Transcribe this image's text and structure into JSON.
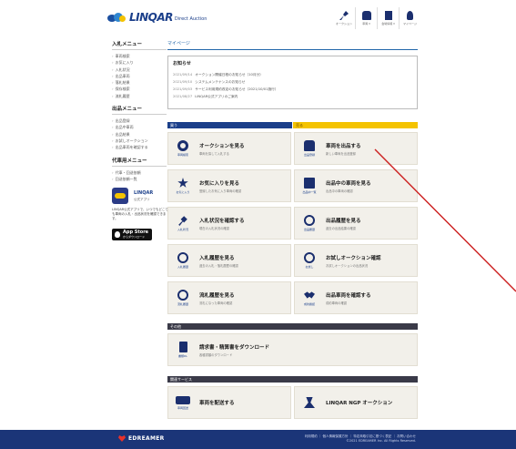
{
  "header": {
    "logo_text": "LINQAR",
    "logo_sub": "Direct Auction",
    "icons": [
      {
        "icon": "hammer-icon",
        "label": "オークション"
      },
      {
        "icon": "car-icon",
        "label": "車両 ▾"
      },
      {
        "icon": "building-icon",
        "label": "会場情報 ▾"
      },
      {
        "icon": "user-icon",
        "label": "マイページ"
      }
    ]
  },
  "sidebar": {
    "sections": [
      {
        "title": "入札メニュー",
        "items": [
          "車両検索",
          "お気に入り",
          "入札状況",
          "出品車両",
          "落札結果",
          "保存検索",
          "流札履歴"
        ]
      },
      {
        "title": "出品メニュー",
        "items": [
          "出品登録",
          "出品中車両",
          "出品結果",
          "お試しオークション",
          "出品車両を確認する"
        ]
      },
      {
        "title": "代車用メニュー",
        "items": [
          "代車・回送依頼",
          "回送依頼一覧"
        ]
      }
    ],
    "app": {
      "name": "LINQAR",
      "sub": "公式アプリ",
      "desc": "LINQAR公式アプリで、いつでもどこでも車両の入札・出品状況を確認できます。",
      "store_line1": "App Store",
      "store_line2": "からダウンロード"
    }
  },
  "main": {
    "breadcrumb": "マイページ",
    "news": {
      "title": "お知らせ",
      "rows": [
        {
          "date": "2021/09/14",
          "text": "オークション開催日程のお知らせ（10月分）"
        },
        {
          "date": "2021/09/10",
          "text": "システムメンテナンスのお知らせ"
        },
        {
          "date": "2021/09/03",
          "text": "サービス利用規約改定のお知らせ（2021/10/01施行）"
        },
        {
          "date": "2021/08/27",
          "text": "LINQAR公式アプリのご案内"
        }
      ]
    },
    "buy_label": "買う",
    "sell_label": "売る",
    "buy_cards": [
      {
        "icon": "search-icon",
        "cap": "車両検索",
        "title": "オークションを見る",
        "sub": "車両を探して入札する"
      },
      {
        "icon": "star-icon",
        "cap": "お気に入り",
        "title": "お気に入りを見る",
        "sub": "登録したお気に入り車両の確認"
      },
      {
        "icon": "gavel-icon",
        "cap": "入札状況",
        "title": "入札状況を確認する",
        "sub": "現在の入札状況の確認"
      },
      {
        "icon": "clock-icon",
        "cap": "入札履歴",
        "title": "入札履歴を見る",
        "sub": "過去の入札・落札履歴の確認"
      },
      {
        "icon": "clock-icon",
        "cap": "流札履歴",
        "title": "流札履歴を見る",
        "sub": "流札になった車両の確認"
      }
    ],
    "sell_cards": [
      {
        "icon": "car-icon",
        "cap": "出品登録",
        "title": "車両を出品する",
        "sub": "新しい車両を出品登録"
      },
      {
        "icon": "monitor-icon",
        "cap": "出品中一覧",
        "title": "出品中の車両を見る",
        "sub": "出品中の車両の確認"
      },
      {
        "icon": "clock-icon",
        "cap": "出品履歴",
        "title": "出品履歴を見る",
        "sub": "過去の出品結果の確認"
      },
      {
        "icon": "clock-icon",
        "cap": "お試し",
        "title": "お試しオークション確認",
        "sub": "お試しオークションの出品状況"
      },
      {
        "icon": "handshake-icon",
        "cap": "成約確認",
        "title": "出品車両を確認する",
        "sub": "成約車両の確認"
      }
    ],
    "other_label": "その他",
    "other_card": {
      "icon": "doc-icon",
      "cap": "書類DL",
      "title": "請求書・精算書をダウンロード",
      "sub": "各種書類のダウンロード"
    },
    "related_label": "関連サービス",
    "related_cards": [
      {
        "icon": "tow-icon",
        "cap": "車両回送",
        "title": "車両を配送する",
        "sub": ""
      },
      {
        "icon": "ngp-icon",
        "cap": "",
        "title": "LINQAR NGP オークション",
        "sub": ""
      }
    ]
  },
  "footer": {
    "logo": "EDREAMER",
    "line1": "利用規約 ｜ 個人情報保護方針 ｜ 特定商取引法に基づく表記 ｜ お問い合わせ",
    "line2": "©2021 EDREAMER Inc. All Rights Reserved."
  },
  "colors": {
    "navy": "#1b3f8a",
    "yellow": "#f4c300",
    "card_bg": "#f2f0ea",
    "annotation": "#cc1f1f"
  }
}
